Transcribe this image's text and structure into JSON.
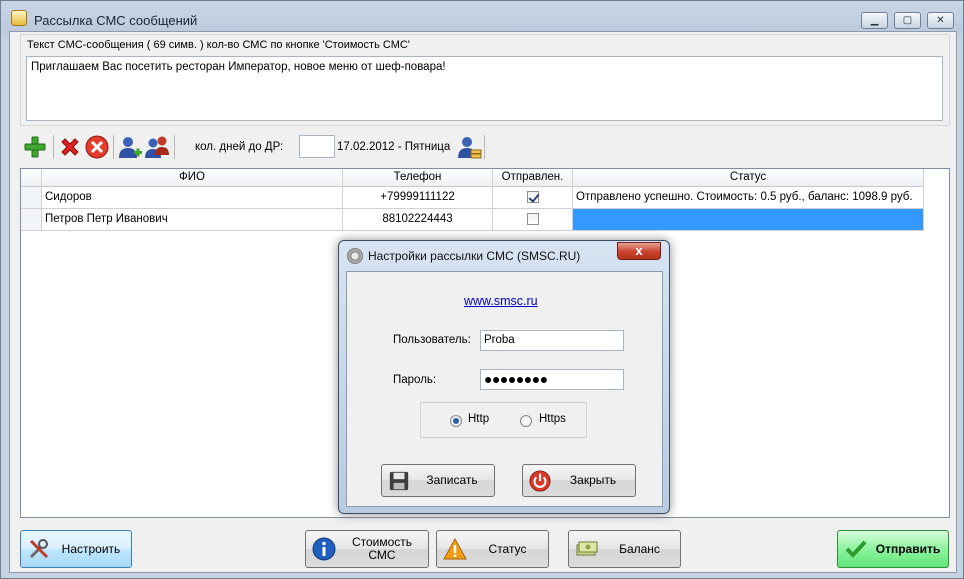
{
  "window": {
    "title": "Рассылка СМС сообщений",
    "controls": {
      "minimize": "▁",
      "maximize": "▢",
      "close": "✕"
    }
  },
  "message": {
    "label": "Текст СМС-сообщения ( 69 симв. )  кол-во СМС по кнопке 'Стоимость СМС'",
    "text": "Приглашаем Вас посетить ресторан Император, новое меню от шеф-повара!"
  },
  "toolbar": {
    "icons": [
      "add-icon",
      "delete-icon",
      "cancel-icon",
      "add-user-icon",
      "users-icon",
      "birthday-users-icon"
    ],
    "days_label": "кол. дней до ДР:",
    "days_value": "",
    "date_text": "17.02.2012 - Пятница"
  },
  "grid": {
    "columns": [
      "ФИО",
      "Телефон",
      "Отправлен.",
      "Статус"
    ],
    "rows": [
      {
        "name": "Сидоров",
        "phone": "+79999111122",
        "sent": true,
        "status": "Отправлено успешно. Стоимость: 0.5 руб., баланс: 1098.9 руб."
      },
      {
        "name": "Петров Петр Иванович",
        "phone": "88102224443",
        "sent": false,
        "status": ""
      }
    ]
  },
  "buttons": {
    "configure": "Настроить",
    "cost": "Стоимость\nСМС",
    "status": "Статус",
    "balance": "Баланс",
    "send": "Отправить"
  },
  "dialog": {
    "title": "Настройки рассылки СМС (SMSC.RU)",
    "close": "x",
    "link": "www.smsc.ru",
    "user_label": "Пользователь:",
    "user_value": "Proba",
    "password_label": "Пароль:",
    "password_value": "●●●●●●●●",
    "protocol_options": [
      "Http",
      "Https"
    ],
    "protocol_selected": "Http",
    "save_button": "Записать",
    "close_button": "Закрыть"
  },
  "colors": {
    "selection": "#3399ff",
    "link": "#0000c8",
    "send_button": "#8df39e"
  }
}
